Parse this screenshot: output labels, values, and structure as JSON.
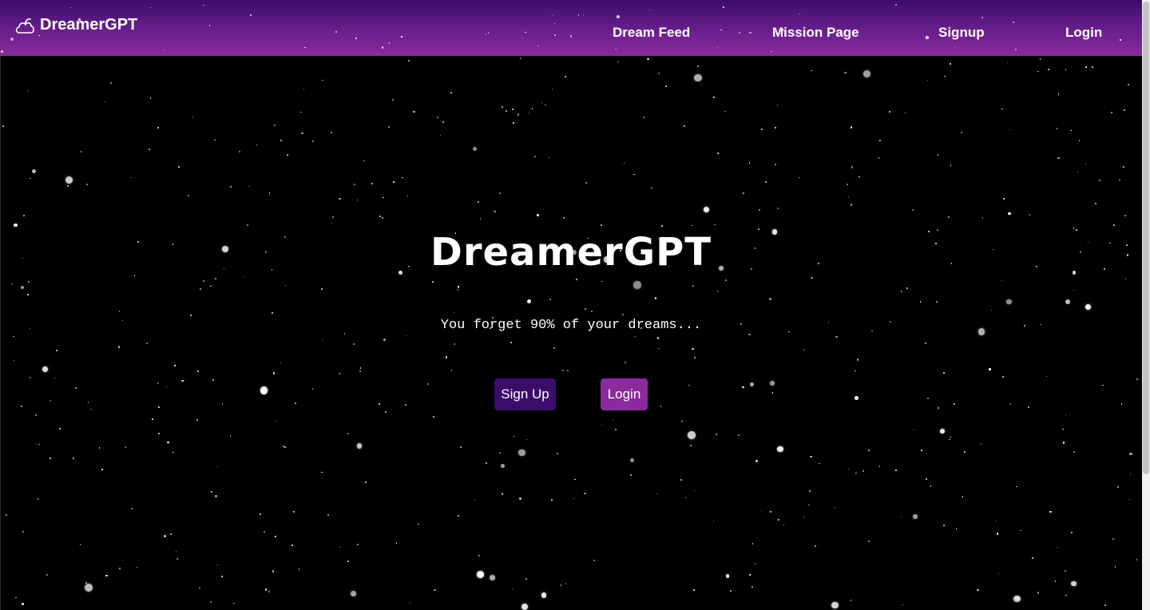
{
  "brand": {
    "name": "DreamerGPT",
    "icon": "cloud-icon"
  },
  "nav": {
    "items": [
      {
        "label": "Dream Feed"
      },
      {
        "label": "Mission Page"
      },
      {
        "label": "Signup"
      },
      {
        "label": "Login"
      }
    ]
  },
  "hero": {
    "title": "DreamerGPT",
    "subtitle": "You forget 90% of your dreams...",
    "signup_label": "Sign Up",
    "login_label": "Login"
  },
  "colors": {
    "nav_gradient_top": "#3a0d6a",
    "nav_gradient_bottom": "#8a2a9c",
    "signup_button": "#3a0d6a",
    "login_button": "#8a2a9c",
    "background": "#000000"
  }
}
